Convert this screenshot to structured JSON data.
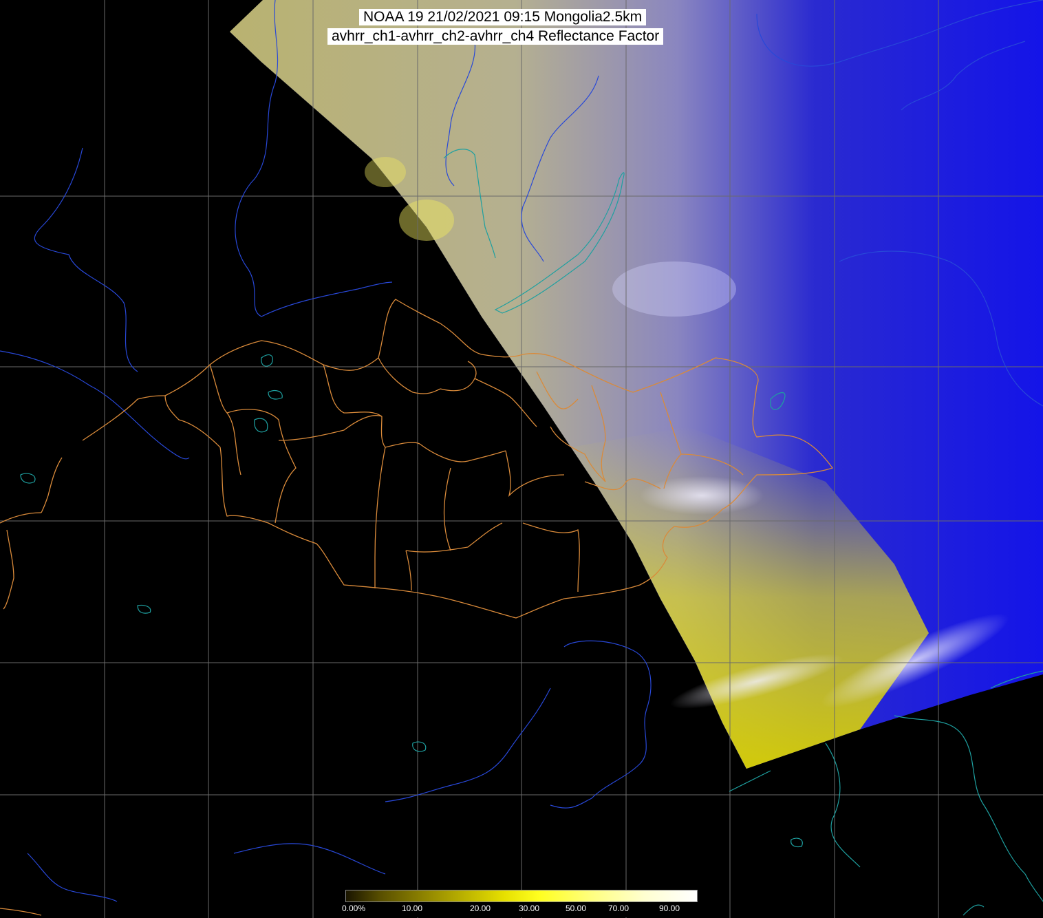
{
  "title": {
    "line1": "NOAA 19 21/02/2021 09:15 Mongolia2.5km",
    "line2": "avhrr_ch1-avhrr_ch2-avhrr_ch4 Reflectance Factor"
  },
  "colorbar": {
    "labels": [
      "0.00%",
      "10.00",
      "20.00",
      "30.00",
      "50.00",
      "70.00",
      "90.00"
    ]
  },
  "colors": {
    "background": "#000000",
    "grid": "#6a6a6a",
    "admin_borders": "#d98a3a",
    "coastline": "#1ea0a0",
    "rivers": "#2040d0",
    "cloud_blue": "#1a1ae0",
    "desert_yellow": "#e0d800"
  }
}
